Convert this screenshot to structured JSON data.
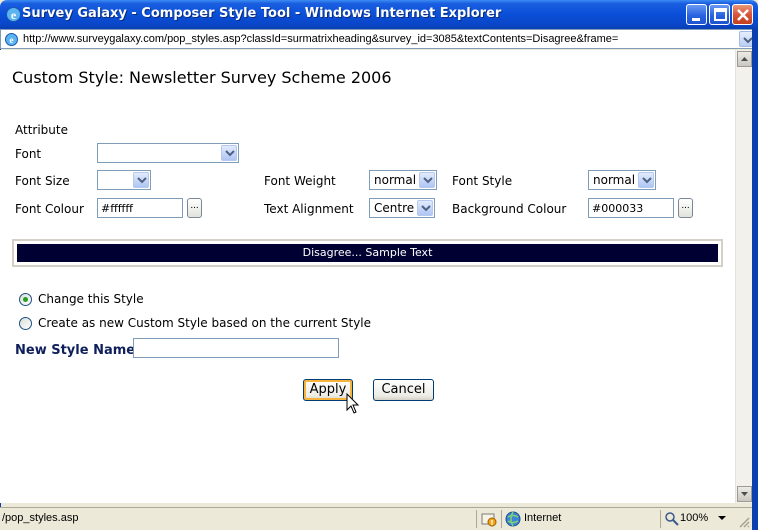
{
  "window": {
    "title": "Survey Galaxy - Composer Style Tool - Windows Internet Explorer",
    "icon": "ie-icon"
  },
  "address": {
    "url": "http://www.surveygalaxy.com/pop_styles.asp?classId=surmatrixheading&survey_id=3085&textContents=Disagree&frame="
  },
  "page": {
    "title": "Custom Style: Newsletter Survey Scheme 2006",
    "attribute_label": "Attribute",
    "font": {
      "label": "Font",
      "value": ""
    },
    "font_size": {
      "label": "Font Size",
      "value": ""
    },
    "font_weight": {
      "label": "Font Weight",
      "value": "normal"
    },
    "font_style": {
      "label": "Font Style",
      "value": "normal"
    },
    "font_colour": {
      "label": "Font Colour",
      "value": "#ffffff",
      "button": "..."
    },
    "text_alignment": {
      "label": "Text Alignment",
      "value": "Centre"
    },
    "background_colour": {
      "label": "Background Colour",
      "value": "#000033",
      "button": "..."
    },
    "sample_text": "Disagree... Sample Text",
    "options": {
      "change": "Change this Style",
      "create": "Create as new Custom Style based on the current Style",
      "selected": "change"
    },
    "new_style_name": {
      "label": "New Style Name",
      "value": ""
    },
    "apply_label": "Apply",
    "cancel_label": "Cancel"
  },
  "status": {
    "text": "/pop_styles.asp",
    "zone": "Internet",
    "zoom": "100%"
  },
  "colors": {
    "sample_bg": "#000033",
    "sample_fg": "#ffffff",
    "title_bar": "#0a4fd8"
  }
}
